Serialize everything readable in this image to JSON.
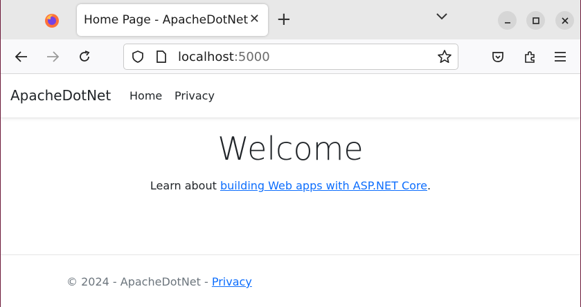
{
  "browser": {
    "tab": {
      "title": "Home Page - ApacheDotNet",
      "close_icon": "close-icon"
    },
    "new_tab_label": "+",
    "url": {
      "host": "localhost",
      "port": ":5000"
    },
    "icons": {
      "firefox": "firefox-icon",
      "back": "back-arrow-icon",
      "forward": "forward-arrow-icon",
      "reload": "reload-icon",
      "shield": "tracking-shield-icon",
      "page": "page-icon",
      "star": "star-icon",
      "pocket": "pocket-icon",
      "extensions": "extensions-icon",
      "menu": "hamburger-menu-icon",
      "tab_list": "chevron-down-icon",
      "minimize": "minimize-icon",
      "maximize": "maximize-icon",
      "close_window": "close-window-icon"
    }
  },
  "site": {
    "brand": "ApacheDotNet",
    "nav": [
      "Home",
      "Privacy"
    ],
    "heading": "Welcome",
    "learn_prefix": "Learn about ",
    "learn_link": "building Web apps with ASP.NET Core",
    "learn_suffix": ".",
    "footer_prefix": "© 2024 - ApacheDotNet - ",
    "footer_link": "Privacy"
  },
  "colors": {
    "link": "#0d6efd",
    "text": "#212529",
    "muted": "#6c757d",
    "window_border": "#6d1a3a"
  }
}
